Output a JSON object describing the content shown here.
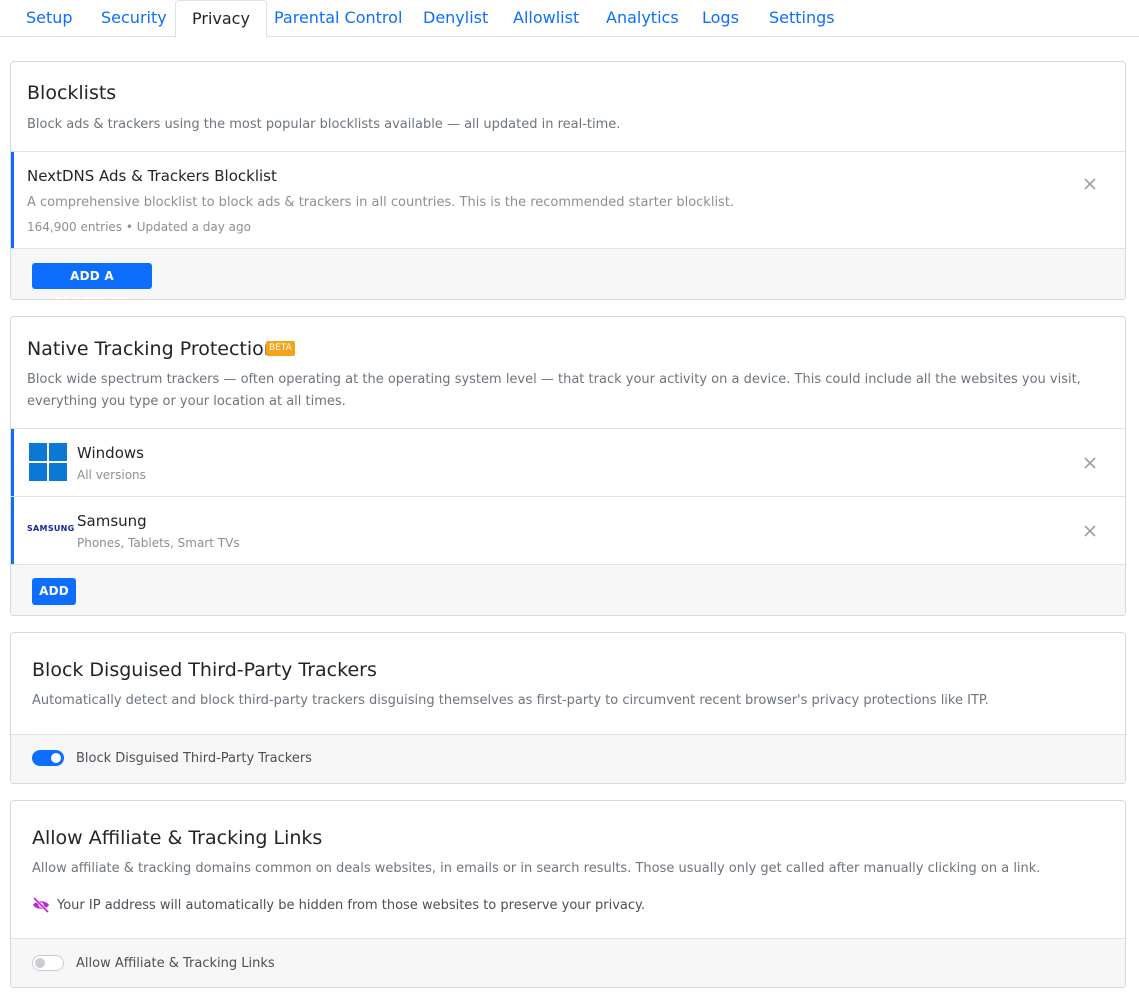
{
  "tabs": [
    {
      "label": "Setup"
    },
    {
      "label": "Security"
    },
    {
      "label": "Privacy"
    },
    {
      "label": "Parental Control"
    },
    {
      "label": "Denylist"
    },
    {
      "label": "Allowlist"
    },
    {
      "label": "Analytics"
    },
    {
      "label": "Logs"
    },
    {
      "label": "Settings"
    }
  ],
  "active_tab": "Privacy",
  "blocklists": {
    "title": "Blocklists",
    "description": "Block ads & trackers using the most popular blocklists available — all updated in real-time.",
    "items": [
      {
        "name": "NextDNS Ads & Trackers Blocklist",
        "description": "A comprehensive blocklist to block ads & trackers in all countries. This is the recommended starter blocklist.",
        "meta": "164,900 entries • Updated a day ago"
      }
    ],
    "add_button": "ADD A BLOCKLIST"
  },
  "native_tracking": {
    "title": "Native Tracking Protection",
    "badge": "BETA",
    "description": "Block wide spectrum trackers — often operating at the operating system level — that track your activity on a device. This could include all the websites you visit, everything you type or your location at all times.",
    "items": [
      {
        "name": "Windows",
        "sub": "All versions",
        "icon": "windows-logo-icon"
      },
      {
        "name": "Samsung",
        "sub": "Phones, Tablets, Smart TVs",
        "icon": "samsung-logo-icon",
        "logo_text": "SAMSUNG"
      }
    ],
    "add_button": "ADD"
  },
  "disguised_trackers": {
    "title": "Block Disguised Third-Party Trackers",
    "description": "Automatically detect and block third-party trackers disguising themselves as first-party to circumvent recent browser's privacy protections like ITP.",
    "toggle_label": "Block Disguised Third-Party Trackers",
    "toggle_on": true
  },
  "affiliate_links": {
    "title": "Allow Affiliate & Tracking Links",
    "description": "Allow affiliate & tracking domains common on deals websites, in emails or in search results. Those usually only get called after manually clicking on a link.",
    "note": "Your IP address will automatically be hidden from those websites to preserve your privacy.",
    "note_icon": "eye-slash-icon",
    "toggle_label": "Allow Affiliate & Tracking Links",
    "toggle_on": false
  },
  "colors": {
    "accent": "#0d6efd",
    "beta_badge": "#f5a31a",
    "note_icon": "#c026d3"
  }
}
